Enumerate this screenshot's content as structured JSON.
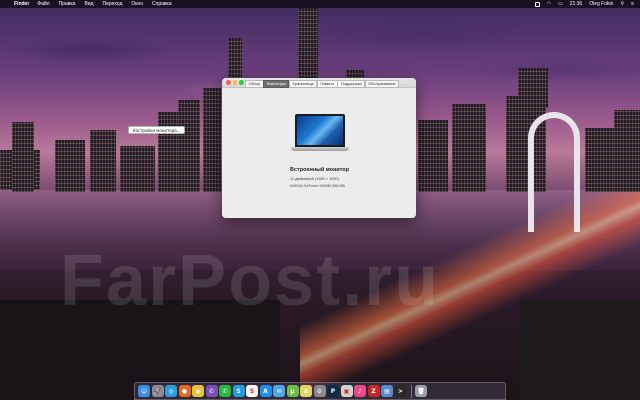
{
  "menubar": {
    "apple_icon": "apple-icon",
    "app_name": "Finder",
    "items": [
      "Файл",
      "Правка",
      "Вид",
      "Переход",
      "Окно",
      "Справка"
    ],
    "clock": "21:36",
    "user": "Oleg Fokin"
  },
  "window": {
    "tabs": [
      "Обзор",
      "Мониторы",
      "Хранилище",
      "Память",
      "Поддержка",
      "Обслуживание"
    ],
    "active_tab": "Мониторы",
    "display_name": "Встроенный монитор",
    "display_size": "11-дюймовый (1680 × 1050)",
    "graphics": "NVIDIA GeForce 9400M 256 МБ",
    "settings_button": "Настройки монитора..."
  },
  "watermark": "FarPost.ru",
  "dock": {
    "icons": [
      {
        "name": "finder-icon",
        "color": "#3a8ee6",
        "glyph": "☺"
      },
      {
        "name": "launchpad-icon",
        "color": "#8a8a9a",
        "glyph": "🚀"
      },
      {
        "name": "safari-icon",
        "color": "#2a9de0",
        "glyph": "◎"
      },
      {
        "name": "firefox-icon",
        "color": "#e66a1e",
        "glyph": "●"
      },
      {
        "name": "chrome-icon",
        "color": "#e8c13a",
        "glyph": "◉"
      },
      {
        "name": "viber-icon",
        "color": "#7a4fb8",
        "glyph": "✆"
      },
      {
        "name": "whatsapp-icon",
        "color": "#2cb742",
        "glyph": "✆"
      },
      {
        "name": "skype-icon",
        "color": "#1ea0e0",
        "glyph": "S"
      },
      {
        "name": "calendar-icon",
        "color": "#f4f4f4",
        "glyph": "5"
      },
      {
        "name": "app-store-icon",
        "color": "#1f8ef0",
        "glyph": "A"
      },
      {
        "name": "mail-icon",
        "color": "#4aa7e8",
        "glyph": "✉"
      },
      {
        "name": "utorrent-icon",
        "color": "#6cbe45",
        "glyph": "µ"
      },
      {
        "name": "notes-icon",
        "color": "#e8d36a",
        "glyph": "≡"
      },
      {
        "name": "system-preferences-icon",
        "color": "#8a8a8a",
        "glyph": "⚙"
      },
      {
        "name": "photoshop-icon",
        "color": "#0c2a4a",
        "glyph": "P"
      },
      {
        "name": "preview-icon",
        "color": "#d2d2d2",
        "glyph": "▣"
      },
      {
        "name": "itunes-icon",
        "color": "#e84a8a",
        "glyph": "♪"
      },
      {
        "name": "filezilla-icon",
        "color": "#c8262a",
        "glyph": "Z"
      },
      {
        "name": "image-capture-icon",
        "color": "#5a8ac8",
        "glyph": "▤"
      },
      {
        "name": "terminal-icon",
        "color": "#2a2a2a",
        "glyph": ">"
      }
    ],
    "trash_icon": {
      "name": "trash-icon",
      "color": "#9aa0a8",
      "glyph": "🗑"
    }
  }
}
